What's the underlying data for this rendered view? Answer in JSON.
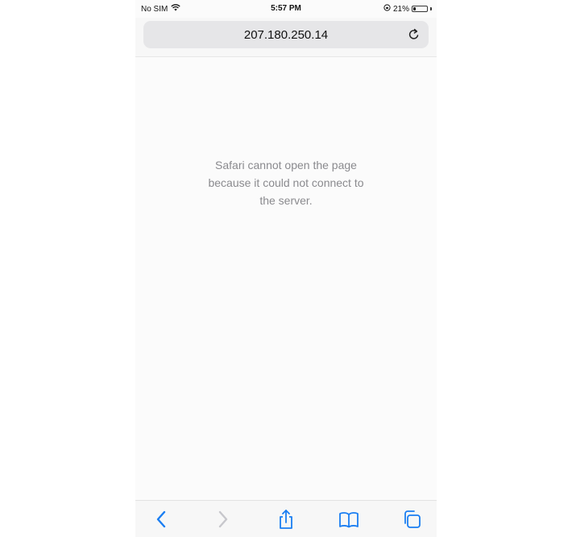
{
  "status_bar": {
    "carrier": "No SIM",
    "time": "5:57 PM",
    "battery": "21%",
    "battery_level": 0.21,
    "icons": [
      "wifi-icon",
      "orientation-lock-icon",
      "battery-icon"
    ]
  },
  "address_bar": {
    "url": "207.180.250.14",
    "reload_icon": "reload-icon"
  },
  "content": {
    "error_lines": [
      "Safari cannot open the page",
      "because it could not connect to",
      "the server."
    ]
  },
  "toolbar": {
    "buttons": [
      "back-icon",
      "forward-icon",
      "share-icon",
      "bookmarks-icon",
      "tabs-icon"
    ]
  },
  "colors": {
    "accent": "#1a7ef2",
    "disabled": "#c7c7cc",
    "error_text": "#8a8a8e"
  }
}
